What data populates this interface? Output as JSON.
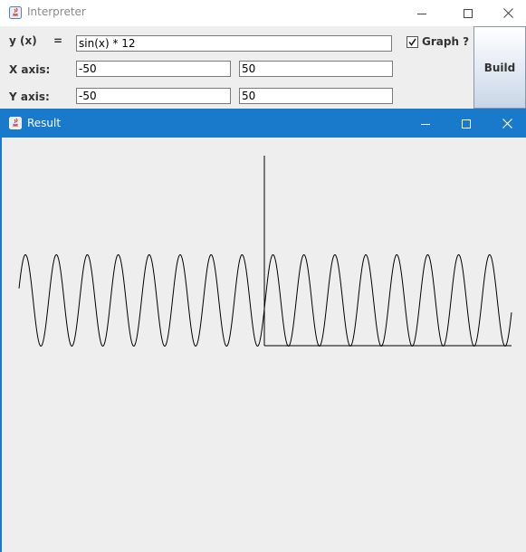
{
  "interpreter": {
    "title": "Interpreter",
    "y_label": "y (x)",
    "equals": "=",
    "function_value": "sin(x) * 12",
    "graph_checkbox": {
      "label": "Graph ?",
      "checked": true
    },
    "x_axis": {
      "label": "X axis:",
      "min": "-50",
      "max": "50"
    },
    "y_axis": {
      "label": "Y axis:",
      "min": "-50",
      "max": "50"
    },
    "build_label": "Build"
  },
  "result": {
    "title": "Result"
  },
  "colors": {
    "result_titlebar": "#1979ca",
    "panel_bg": "#eeeeee",
    "curve": "#000000"
  },
  "chart_data": {
    "type": "line",
    "function": "sin(x) * 12",
    "xlim": [
      -50,
      50
    ],
    "ylim": [
      -50,
      50
    ],
    "grid": false,
    "title": "",
    "xlabel": "",
    "ylabel": ""
  }
}
